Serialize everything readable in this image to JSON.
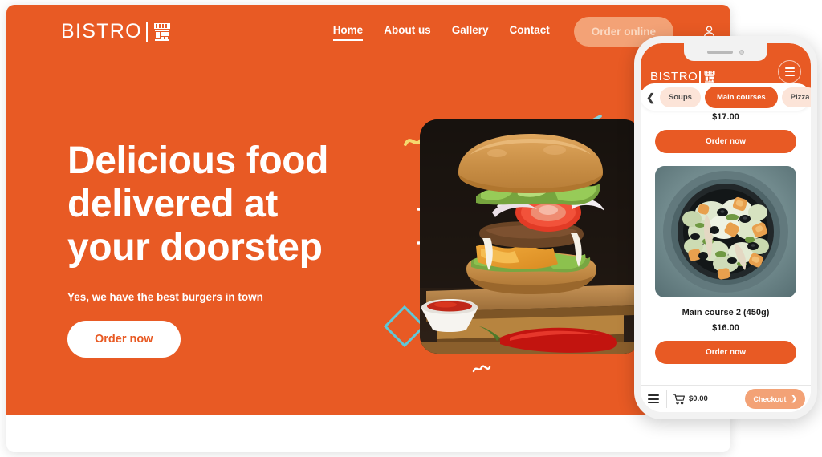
{
  "colors": {
    "brand_orange": "#e85a24",
    "light_orange": "#f3a276",
    "chip_peach": "#fce4d8",
    "white": "#ffffff",
    "deco_yellow": "#f5d76e",
    "deco_cyan": "#7fd4e0",
    "deco_purple": "#a9a0d8"
  },
  "site": {
    "brand": {
      "wordmark": "BISTRO",
      "icon": "storefront-icon"
    },
    "nav": [
      {
        "label": "Home",
        "active": true
      },
      {
        "label": "About us",
        "active": false
      },
      {
        "label": "Gallery",
        "active": false
      },
      {
        "label": "Contact",
        "active": false
      }
    ],
    "order_online_label": "Order online",
    "account_icon": "user-icon"
  },
  "hero": {
    "title_line1": "Delicious food",
    "title_line2": "delivered at",
    "title_line3": "your doorstep",
    "subtitle": "Yes, we have the best burgers in town",
    "cta_label": "Order now",
    "photo_alt": "burger-photo"
  },
  "decorations": [
    {
      "name": "yellow-squiggle",
      "color": "#f5d76e"
    },
    {
      "name": "white-arc",
      "color": "#ffffff"
    },
    {
      "name": "cyan-diamond",
      "color": "#7fd4e0"
    },
    {
      "name": "white-squiggle",
      "color": "#ffffff"
    },
    {
      "name": "cyan-line-top",
      "color": "#7fd4e0"
    },
    {
      "name": "yellow-square",
      "color": "#f5d76e"
    },
    {
      "name": "cyan-line-low",
      "color": "#7fd4e0"
    },
    {
      "name": "purple-squiggle",
      "color": "#a9a0d8"
    }
  ],
  "phone": {
    "brand": {
      "wordmark": "BISTRO",
      "icon": "storefront-icon"
    },
    "menu_icon": "hamburger-icon",
    "categories": {
      "prev_icon": "chevron-left-icon",
      "next_icon": "chevron-right-icon",
      "items": [
        {
          "label": "Soups",
          "active": false
        },
        {
          "label": "Main courses",
          "active": true
        },
        {
          "label": "Pizza",
          "active": false
        }
      ]
    },
    "items": [
      {
        "price": "$17.00",
        "order_label": "Order now",
        "partial": true
      },
      {
        "name": "Main course 2 (450g)",
        "price": "$16.00",
        "order_label": "Order now",
        "photo_alt": "caesar-salad-photo",
        "partial": false
      }
    ],
    "bottom_bar": {
      "menu_icon": "hamburger-icon",
      "cart_icon": "shopping-cart-icon",
      "cart_total": "$0.00",
      "checkout_label": "Checkout",
      "checkout_icon": "chevron-right-icon"
    }
  }
}
